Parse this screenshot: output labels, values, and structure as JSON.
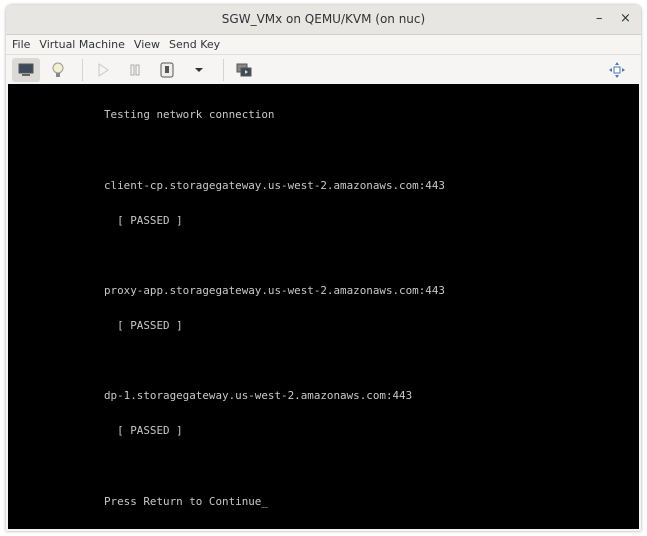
{
  "window": {
    "title": "SGW_VMx on QEMU/KVM (on nuc)",
    "minimize": "–",
    "close": "×"
  },
  "menu": [
    "File",
    "Virtual Machine",
    "View",
    "Send Key"
  ],
  "toolbar": [
    "console-icon",
    "details-lightbulb-icon",
    "run-icon",
    "pause-icon",
    "shutdown-icon",
    "shutdown-menu-chevron",
    "snapshots-icon",
    "fullscreen-icon"
  ],
  "console": {
    "heading": "Testing network connection",
    "checks": [
      {
        "host": "client-cp.storagegateway.us-west-2.amazonaws.com:443",
        "status": "  [ PASSED ]"
      },
      {
        "host": "proxy-app.storagegateway.us-west-2.amazonaws.com:443",
        "status": "  [ PASSED ]"
      },
      {
        "host": "dp-1.storagegateway.us-west-2.amazonaws.com:443",
        "status": "  [ PASSED ]"
      }
    ],
    "prompt": "Press Return to Continue",
    "cursor": "_"
  }
}
